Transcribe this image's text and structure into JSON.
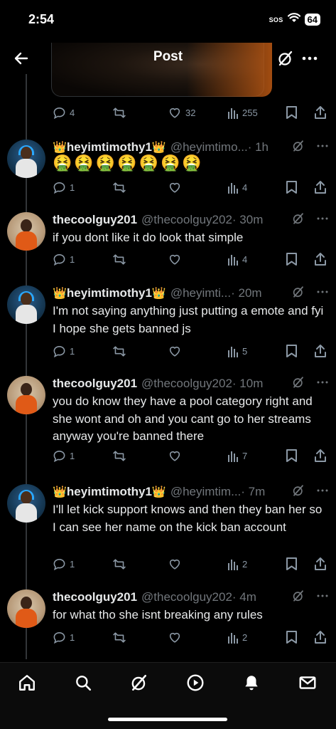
{
  "status_bar": {
    "time": "2:54",
    "sos": "SOS",
    "battery": "64"
  },
  "header": {
    "title": "Post"
  },
  "top_actions": {
    "replies": "4",
    "reposts": "",
    "likes": "32",
    "views": "255"
  },
  "tweets": [
    {
      "name": "heyimtimothy1",
      "crowns": true,
      "handle": "@heyimtimo...",
      "time": "· 1h",
      "body": "🤮🤮🤮🤮🤮🤮🤮",
      "replies": "1",
      "likes": "",
      "views": "4"
    },
    {
      "name": "thecoolguy201",
      "crowns": false,
      "handle": "@thecoolguy202",
      "time": "· 30m",
      "body": "if you dont like it do look that simple",
      "replies": "1",
      "likes": "",
      "views": "4"
    },
    {
      "name": "heyimtimothy1",
      "crowns": true,
      "handle": "@heyimti...",
      "time": "· 20m",
      "body": "I'm not saying anything just putting a emote and fyi I hope she gets banned js",
      "replies": "1",
      "likes": "",
      "views": "5"
    },
    {
      "name": "thecoolguy201",
      "crowns": false,
      "handle": "@thecoolguy202",
      "time": "· 10m",
      "body": "you do know they have a pool category right and she wont and oh and you cant go to her streams anyway you're banned there",
      "replies": "1",
      "likes": "",
      "views": "7"
    },
    {
      "name": "heyimtimothy1",
      "crowns": true,
      "handle": "@heyimtim...",
      "time": "· 7m",
      "body": "I'll let kick support knows and then they ban her so I can see her name on the kick ban account",
      "replies": "1",
      "likes": "",
      "views": "2"
    },
    {
      "name": "thecoolguy201",
      "crowns": false,
      "handle": "@thecoolguy202",
      "time": "· 4m",
      "body": "for what tho she isnt breaking any rules",
      "replies": "1",
      "likes": "",
      "views": "2"
    }
  ],
  "crown_emoji": "👑",
  "icons": {
    "back": "arrow-left-icon",
    "grok": "grok-icon",
    "more": "more-dots-icon",
    "reply": "reply-icon",
    "repost": "repost-icon",
    "like": "heart-icon",
    "views": "views-icon",
    "bookmark": "bookmark-icon",
    "share": "share-icon",
    "nav": [
      "home-icon",
      "search-icon",
      "grok-icon",
      "play-icon",
      "bell-icon",
      "mail-icon"
    ]
  },
  "colors": {
    "background": "#000000",
    "text": "#e7e9ea",
    "muted": "#71767b",
    "divider": "#333639"
  }
}
